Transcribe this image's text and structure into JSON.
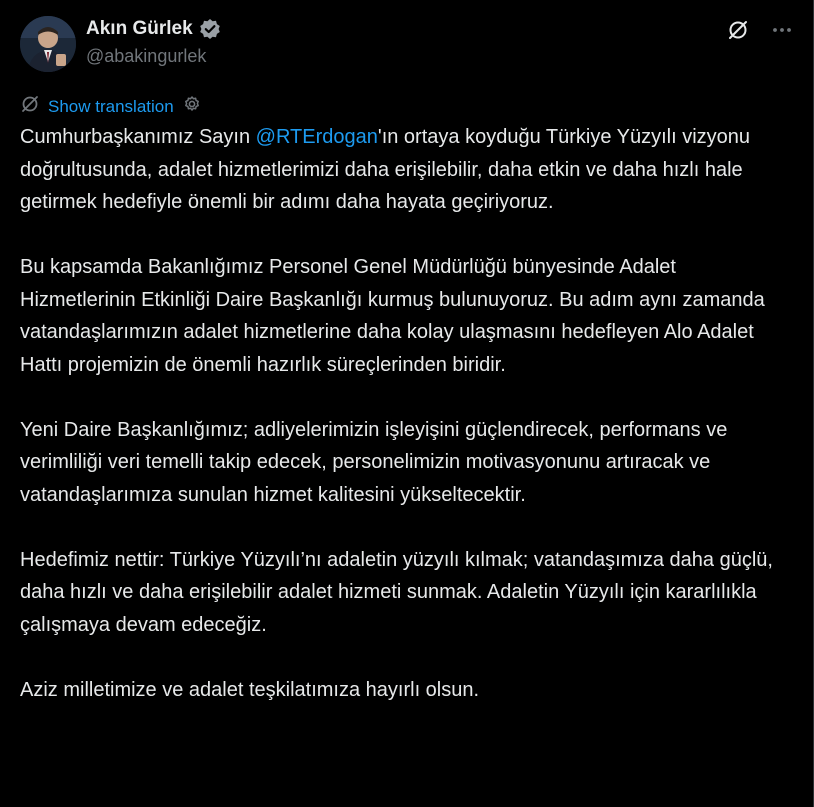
{
  "author": {
    "display_name": "Akın Gürlek",
    "handle": "@abakingurlek",
    "verified": true
  },
  "actions": {
    "grok_icon": "slash-circle-icon",
    "more_icon": "more-icon"
  },
  "translate": {
    "label": "Show translation"
  },
  "tweet": {
    "p1_pre": "Cumhurbaşkanımız Sayın ",
    "p1_mention": "@RTErdogan",
    "p1_post": "'ın ortaya koyduğu Türkiye Yüzyılı vizyonu doğrultusunda, adalet hizmetlerimizi daha erişilebilir, daha etkin ve daha hızlı hale getirmek hedefiyle önemli bir adımı daha hayata geçiriyoruz.",
    "p2": "Bu kapsamda Bakanlığımız Personel Genel Müdürlüğü bünyesinde Adalet Hizmetlerinin Etkinliği Daire Başkanlığı kurmuş bulunuyoruz. Bu adım aynı zamanda vatandaşlarımızın adalet hizmetlerine daha kolay ulaşmasını hedefleyen Alo Adalet Hattı projemizin de önemli hazırlık süreçlerinden biridir.",
    "p3": "Yeni Daire Başkanlığımız; adliyelerimizin işleyişini güçlendirecek, performans ve verimliliği veri temelli takip edecek, personelimizin motivasyonunu artıracak ve vatandaşlarımıza sunulan hizmet kalitesini yükseltecektir.",
    "p4": "Hedefimiz nettir: Türkiye Yüzyılı’nı adaletin yüzyılı kılmak; vatandaşımıza daha güçlü, daha hızlı ve daha erişilebilir adalet hizmeti sunmak. Adaletin Yüzyılı için kararlılıkla çalışmaya devam edeceğiz.",
    "p5": "Aziz milletimize ve adalet teşkilatımıza hayırlı olsun."
  },
  "colors": {
    "background": "#000000",
    "text": "#e7e9ea",
    "secondary": "#71767b",
    "accent": "#1d9bf0"
  }
}
